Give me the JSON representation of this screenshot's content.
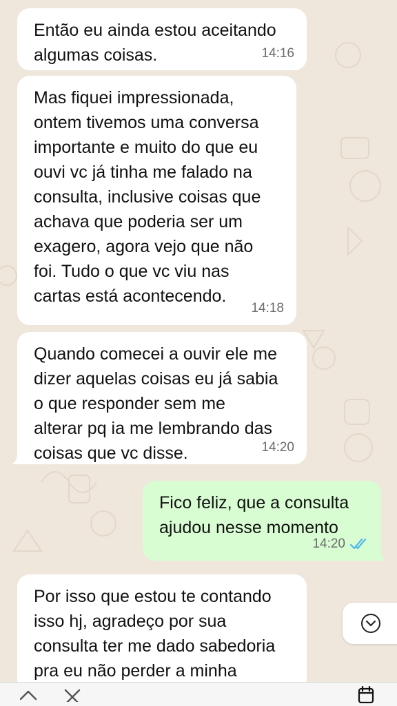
{
  "messages": [
    {
      "text": "Então eu ainda estou aceitando\nalgumas coisas.",
      "time": "14:16",
      "direction": "incoming"
    },
    {
      "text": "Mas fiquei impressionada,\nontem tivemos uma conversa\nimportante e muito do que eu\nouvi vc já tinha me falado na\nconsulta, inclusive coisas que\nachava que poderia ser um\nexagero, agora vejo que não\nfoi. Tudo o que vc viu nas\ncartas está acontecendo.",
      "time": "14:18",
      "direction": "incoming"
    },
    {
      "text": "Quando comecei a ouvir ele me\ndizer aquelas coisas eu já sabia\no que responder sem me\nalterar pq ia me lembrando das\ncoisas que vc disse.",
      "time": "14:20",
      "direction": "incoming"
    },
    {
      "text": "Fico feliz, que a consulta\najudou nesse momento",
      "time": "14:20",
      "direction": "outgoing",
      "status": "read"
    },
    {
      "text": "Por isso que estou te contando\nisso hj, agradeço por sua\nconsulta ter me dado sabedoria\npra eu não perder a minha",
      "time": "",
      "direction": "incoming"
    }
  ],
  "colors": {
    "background": "#efe7dc",
    "incoming_bubble": "#ffffff",
    "outgoing_bubble": "#d9fdd3",
    "read_ticks": "#4fb6ec"
  },
  "icons": {
    "scroll_down": "chevron-down-circle-icon",
    "prev": "chevron-up-icon",
    "close": "close-icon",
    "calendar": "calendar-icon"
  }
}
